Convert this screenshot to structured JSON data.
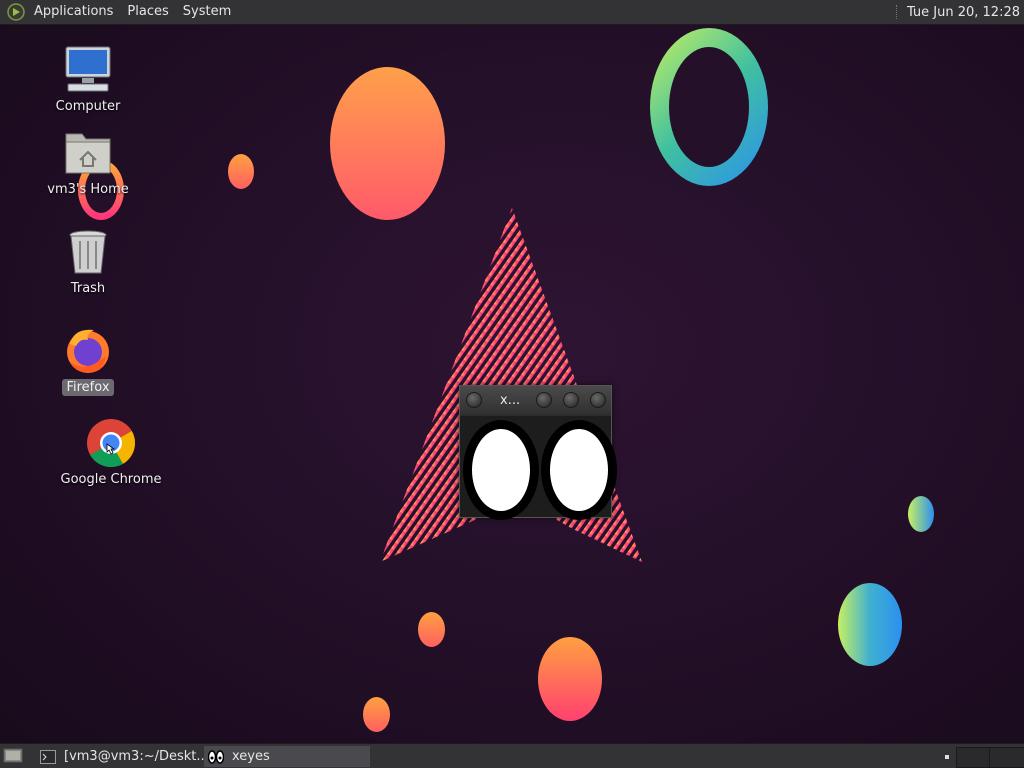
{
  "top_panel": {
    "menus": [
      "Applications",
      "Places",
      "System"
    ],
    "clock": "Tue Jun 20, 12:28"
  },
  "desktop_icons": [
    {
      "label": "Computer",
      "icon": "computer-icon"
    },
    {
      "label": "vm3's Home",
      "icon": "home-folder-icon"
    },
    {
      "label": "Trash",
      "icon": "trash-icon"
    },
    {
      "label": "Firefox",
      "icon": "firefox-icon",
      "selected": true
    },
    {
      "label": "Google Chrome",
      "icon": "chrome-icon"
    }
  ],
  "xeyes_window": {
    "title": "x..."
  },
  "taskbar": {
    "tasks": [
      {
        "label": "[vm3@vm3:~/Deskt...",
        "icon": "terminal-icon"
      },
      {
        "label": "xeyes",
        "icon": "eyes-icon",
        "active": true
      }
    ]
  },
  "colors": {
    "panel": "#333235",
    "desktop_bg": "#241029"
  }
}
